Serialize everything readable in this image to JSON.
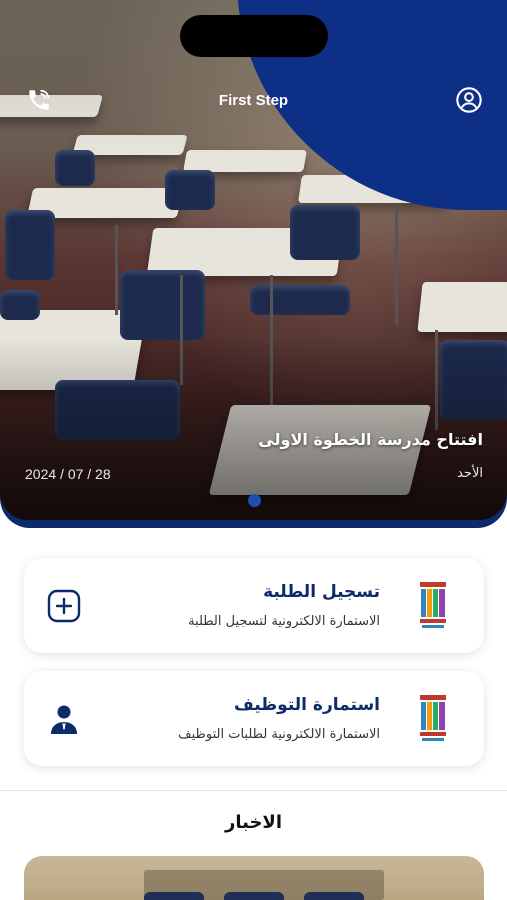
{
  "app": {
    "title": "First Step"
  },
  "header": {
    "phone_icon": "phone-icon",
    "account_icon": "account-circle-icon"
  },
  "hero": {
    "headline": "افتتاح مدرسة الخطوة الاولى",
    "day": "الأحد",
    "date": "2024 / 07 / 28",
    "active_slide": 1,
    "slide_count": 1
  },
  "cards": [
    {
      "title": "تسجيل الطلبة",
      "subtitle": "الاستمارة الالكترونية لتسجيل الطلبة",
      "logo_icon": "school-books-logo",
      "action_icon": "add-square-icon"
    },
    {
      "title": "استمارة التوظيف",
      "subtitle": "الاستمارة الالكترونية لطلبات التوظيف",
      "logo_icon": "school-books-logo",
      "action_icon": "employee-icon"
    }
  ],
  "news": {
    "heading": "الاخبار"
  },
  "colors": {
    "brand": "#0d2f86",
    "title_text": "#0d2a6b",
    "card_bg": "#ffffff"
  }
}
